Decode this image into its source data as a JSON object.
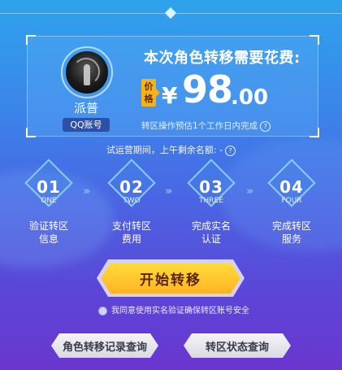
{
  "account": {
    "nickname": "派普",
    "type_badge": "QQ账号"
  },
  "cost": {
    "title": "本次角色转移需要花费:",
    "price_tag": "价格",
    "currency": "¥",
    "amount_int": "98",
    "amount_dec": ".00",
    "note": "转区操作预估1个工作日内完成"
  },
  "quota": {
    "text": "试运营期间，上午剩余名额: -"
  },
  "steps": [
    {
      "num": "01",
      "en": "ONE",
      "label": "验证转区\n信息"
    },
    {
      "num": "02",
      "en": "TWO",
      "label": "支付转区\n费用"
    },
    {
      "num": "03",
      "en": "THREE",
      "label": "完成实名\n认证"
    },
    {
      "num": "04",
      "en": "FOUR",
      "label": "完成转区\n服务"
    }
  ],
  "start_button": "开始转移",
  "agreement": "我同意使用实名验证确保转区账号安全",
  "buttons": {
    "record_query": "角色转移记录查询",
    "status_query": "转区状态查询"
  },
  "colors": {
    "bg_top": "#2fa3ec",
    "bg_bottom": "#6a36cf",
    "start_button": "#ffc326",
    "price_tag": "#f2b21d",
    "account_badge": "#2d4fa6"
  }
}
